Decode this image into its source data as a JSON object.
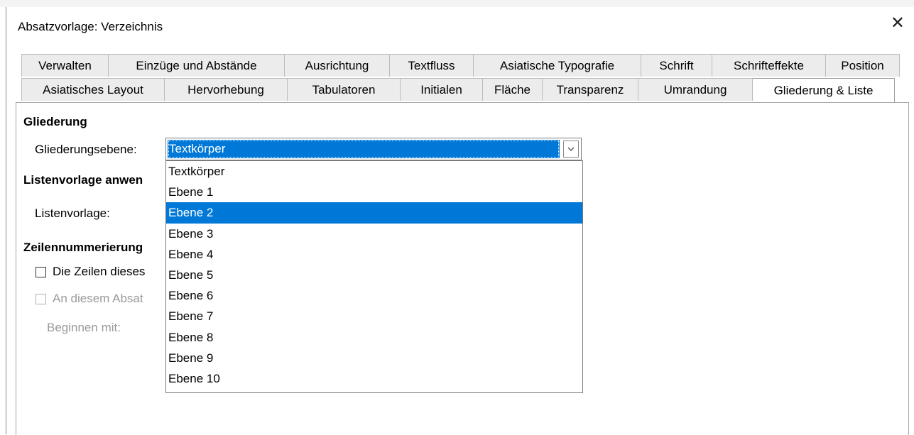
{
  "dialog": {
    "title": "Absatzvorlage: Verzeichnis",
    "close_glyph": "✕"
  },
  "tabs_row1": [
    "Verwalten",
    "Einzüge und Abstände",
    "Ausrichtung",
    "Textfluss",
    "Asiatische Typografie",
    "Schrift",
    "Schrifteffekte",
    "Position"
  ],
  "tabs_row2": [
    "Asiatisches Layout",
    "Hervorhebung",
    "Tabulatoren",
    "Initialen",
    "Fläche",
    "Transparenz",
    "Umrandung",
    "Gliederung & Liste"
  ],
  "active_tab": "Gliederung & Liste",
  "outline": {
    "heading": "Gliederung",
    "level_label": "Gliederungsebene:",
    "level_value": "Textkörper"
  },
  "list_style": {
    "heading": "Listenvorlage anwen",
    "label": "Listenvorlage:"
  },
  "line_numbering": {
    "heading": "Zeilennummerierung",
    "include_lines_label": "Die Zeilen dieses",
    "restart_label": "An diesem Absat",
    "start_with_label": "Beginnen mit:"
  },
  "dropdown": {
    "items": [
      "Textkörper",
      "Ebene 1",
      "Ebene 2",
      "Ebene 3",
      "Ebene 4",
      "Ebene 5",
      "Ebene 6",
      "Ebene 7",
      "Ebene 8",
      "Ebene 9",
      "Ebene 10"
    ],
    "highlighted": "Ebene 2"
  },
  "colors": {
    "accent": "#0078d7",
    "disabled_text": "#9a9a9a",
    "tab_bg": "#ececec"
  }
}
